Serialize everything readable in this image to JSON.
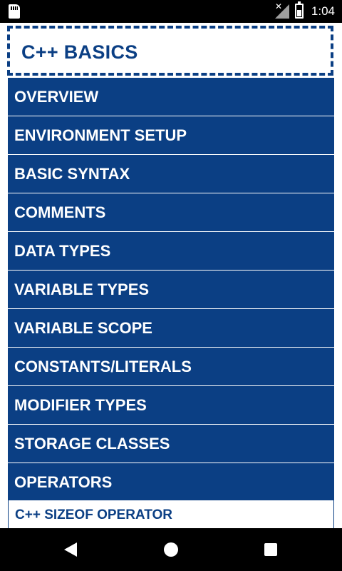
{
  "status_bar": {
    "time": "1:04",
    "icons": [
      "sd-card-icon",
      "signal-off-icon",
      "battery-charging-icon"
    ]
  },
  "header": {
    "title": "C++ BASICS"
  },
  "menu": {
    "items": [
      {
        "label": "OVERVIEW"
      },
      {
        "label": "ENVIRONMENT SETUP"
      },
      {
        "label": "BASIC SYNTAX"
      },
      {
        "label": "COMMENTS"
      },
      {
        "label": "DATA TYPES"
      },
      {
        "label": "VARIABLE TYPES"
      },
      {
        "label": "VARIABLE SCOPE"
      },
      {
        "label": "CONSTANTS/LITERALS"
      },
      {
        "label": "MODIFIER TYPES"
      },
      {
        "label": "STORAGE CLASSES"
      },
      {
        "label": "OPERATORS"
      }
    ],
    "sub_item": {
      "label": "C++ SIZEOF OPERATOR"
    }
  },
  "nav_bar": {
    "icons": [
      "back-icon",
      "home-icon",
      "recents-icon"
    ]
  },
  "colors": {
    "primary": "#0b3f84",
    "background": "#ffffff",
    "text_on_primary": "#ffffff"
  }
}
